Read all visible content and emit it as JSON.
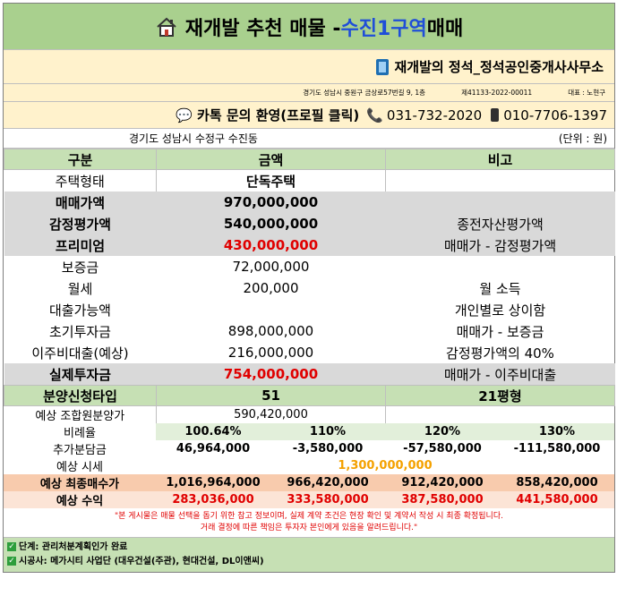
{
  "title": {
    "prefix": "재개발 추천 매물 - ",
    "highlight": "수진1구역",
    "suffix": " 매매"
  },
  "office": {
    "name": "재개발의 정석_정석공인중개사사무소"
  },
  "address_line": {
    "address": "경기도 성남시 중원구 금상로57번길 9, 1층",
    "reg_no": "제41133-2022-00011",
    "rep": "대표 : 노현구"
  },
  "contact": {
    "kakao": "카톡 문의 환영(프로필 클릭)",
    "phone": "031-732-2020",
    "mobile": "010-7706-1397"
  },
  "location": {
    "area": "경기도 성남시 수정구 수진동",
    "unit": "(단위 : 원)"
  },
  "headers": {
    "category": "구분",
    "amount": "금액",
    "note": "비고"
  },
  "rows": [
    {
      "label": "주택형태",
      "value": "단독주택",
      "note": ""
    },
    {
      "label": "매매가액",
      "value": "970,000,000",
      "note": ""
    },
    {
      "label": "감정평가액",
      "value": "540,000,000",
      "note": "종전자산평가액"
    },
    {
      "label": "프리미엄",
      "value": "430,000,000",
      "note": "매매가 - 감정평가액"
    },
    {
      "label": "보증금",
      "value": "72,000,000",
      "note": ""
    },
    {
      "label": "월세",
      "value": "200,000",
      "note": "월 소득"
    },
    {
      "label": "대출가능액",
      "value": "",
      "note": "개인별로 상이함"
    },
    {
      "label": "초기투자금",
      "value": "898,000,000",
      "note": "매매가 - 보증금"
    },
    {
      "label": "이주비대출(예상)",
      "value": "216,000,000",
      "note": "감정평가액의 40%"
    },
    {
      "label": "실제투자금",
      "value": "754,000,000",
      "note": "매매가 - 이주비대출"
    }
  ],
  "type_row": {
    "label": "분양신청타입",
    "value": "51",
    "note": "21평형"
  },
  "est_price": {
    "label": "예상 조합원분양가",
    "value": "590,420,000"
  },
  "ratio": {
    "label": "비례율",
    "values": [
      "100.64%",
      "110%",
      "120%",
      "130%"
    ]
  },
  "extra": {
    "label": "추가분담금",
    "values": [
      "46,964,000",
      "-3,580,000",
      "-57,580,000",
      "-111,580,000"
    ]
  },
  "market": {
    "label": "예상 시세",
    "value": "1,300,000,000"
  },
  "total": {
    "label": "예상 최종매수가",
    "values": [
      "1,016,964,000",
      "966,420,000",
      "912,420,000",
      "858,420,000"
    ]
  },
  "profit": {
    "label": "예상 수익",
    "values": [
      "283,036,000",
      "333,580,000",
      "387,580,000",
      "441,580,000"
    ]
  },
  "disclaimer": {
    "line1": "\"본 게시물은 매물 선택을 돕기 위한 참고 정보이며, 실제 계약 조건은 현장 확인 및 계약서 작성 시 최종 확정됩니다.",
    "line2": "거래 결정에 따른 책임은 투자자 본인에게 있음을 알려드립니다.\""
  },
  "footer": {
    "stage": "단계: 관리처분계획인가 완료",
    "builder": "시공사: 메가시티 사업단 (대우건설(주관), 현대건설, DL이앤씨)"
  }
}
